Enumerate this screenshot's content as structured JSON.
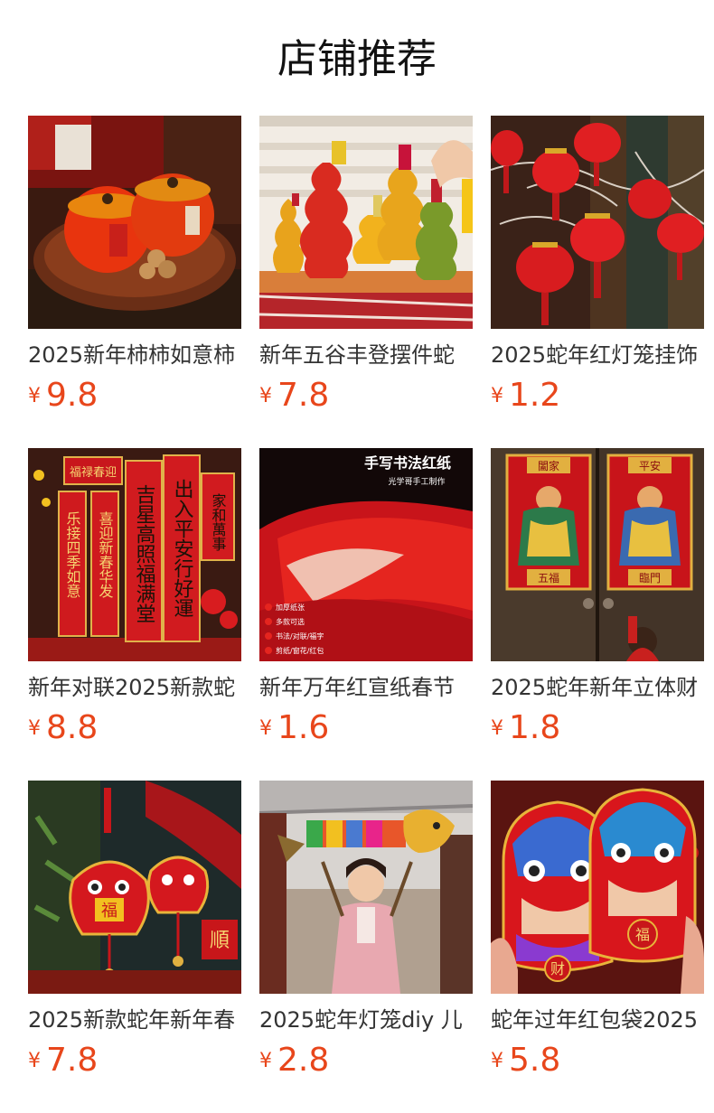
{
  "header": {
    "title": "店铺推荐"
  },
  "products": [
    {
      "title": "2025新年柿柿如意柿",
      "currency": "¥",
      "price": "9.8",
      "image_icon": "persimmon-jars-image"
    },
    {
      "title": "新年五谷丰登摆件蛇",
      "currency": "¥",
      "price": "7.8",
      "image_icon": "grain-bottles-image"
    },
    {
      "title": "2025蛇年红灯笼挂饰",
      "currency": "¥",
      "price": "1.2",
      "image_icon": "red-lanterns-image"
    },
    {
      "title": "新年对联2025新款蛇",
      "currency": "¥",
      "price": "8.8",
      "image_icon": "couplets-image",
      "image_text": {
        "banner": "福禄春迎",
        "col1": "乐接四季如意",
        "col2": "喜迎新春华发",
        "col3": "吉星高照福满堂",
        "col4": "出入平安行好運",
        "side": "家和萬事"
      }
    },
    {
      "title": "新年万年红宣纸春节",
      "currency": "¥",
      "price": "1.6",
      "image_icon": "red-paper-image",
      "image_text": {
        "heading": "手写书法红纸",
        "sub": "光学哥手工制作",
        "features": [
          "加厚纸张",
          "多款可选",
          "书法/对联/福字",
          "剪纸/窗花/红包"
        ]
      }
    },
    {
      "title": "2025蛇年新年立体财",
      "currency": "¥",
      "price": "1.8",
      "image_icon": "door-gods-image",
      "image_text": {
        "left_top": "闔家",
        "right_top": "平安",
        "left_bottom": "五福",
        "right_bottom": "臨門"
      }
    },
    {
      "title": "2025新款蛇年新年春",
      "currency": "¥",
      "price": "7.8",
      "image_icon": "dragon-pendants-image",
      "image_text": {
        "fu": "福",
        "sign": "順"
      }
    },
    {
      "title": "2025蛇年灯笼diy 儿",
      "currency": "¥",
      "price": "2.8",
      "image_icon": "child-dragon-lantern-image"
    },
    {
      "title": "蛇年过年红包袋2025",
      "currency": "¥",
      "price": "5.8",
      "image_icon": "lion-red-envelopes-image",
      "image_text": {
        "left": "财",
        "right": "福"
      }
    }
  ],
  "colors": {
    "price": "#e8461b",
    "title": "#333333",
    "heading": "#111111"
  }
}
